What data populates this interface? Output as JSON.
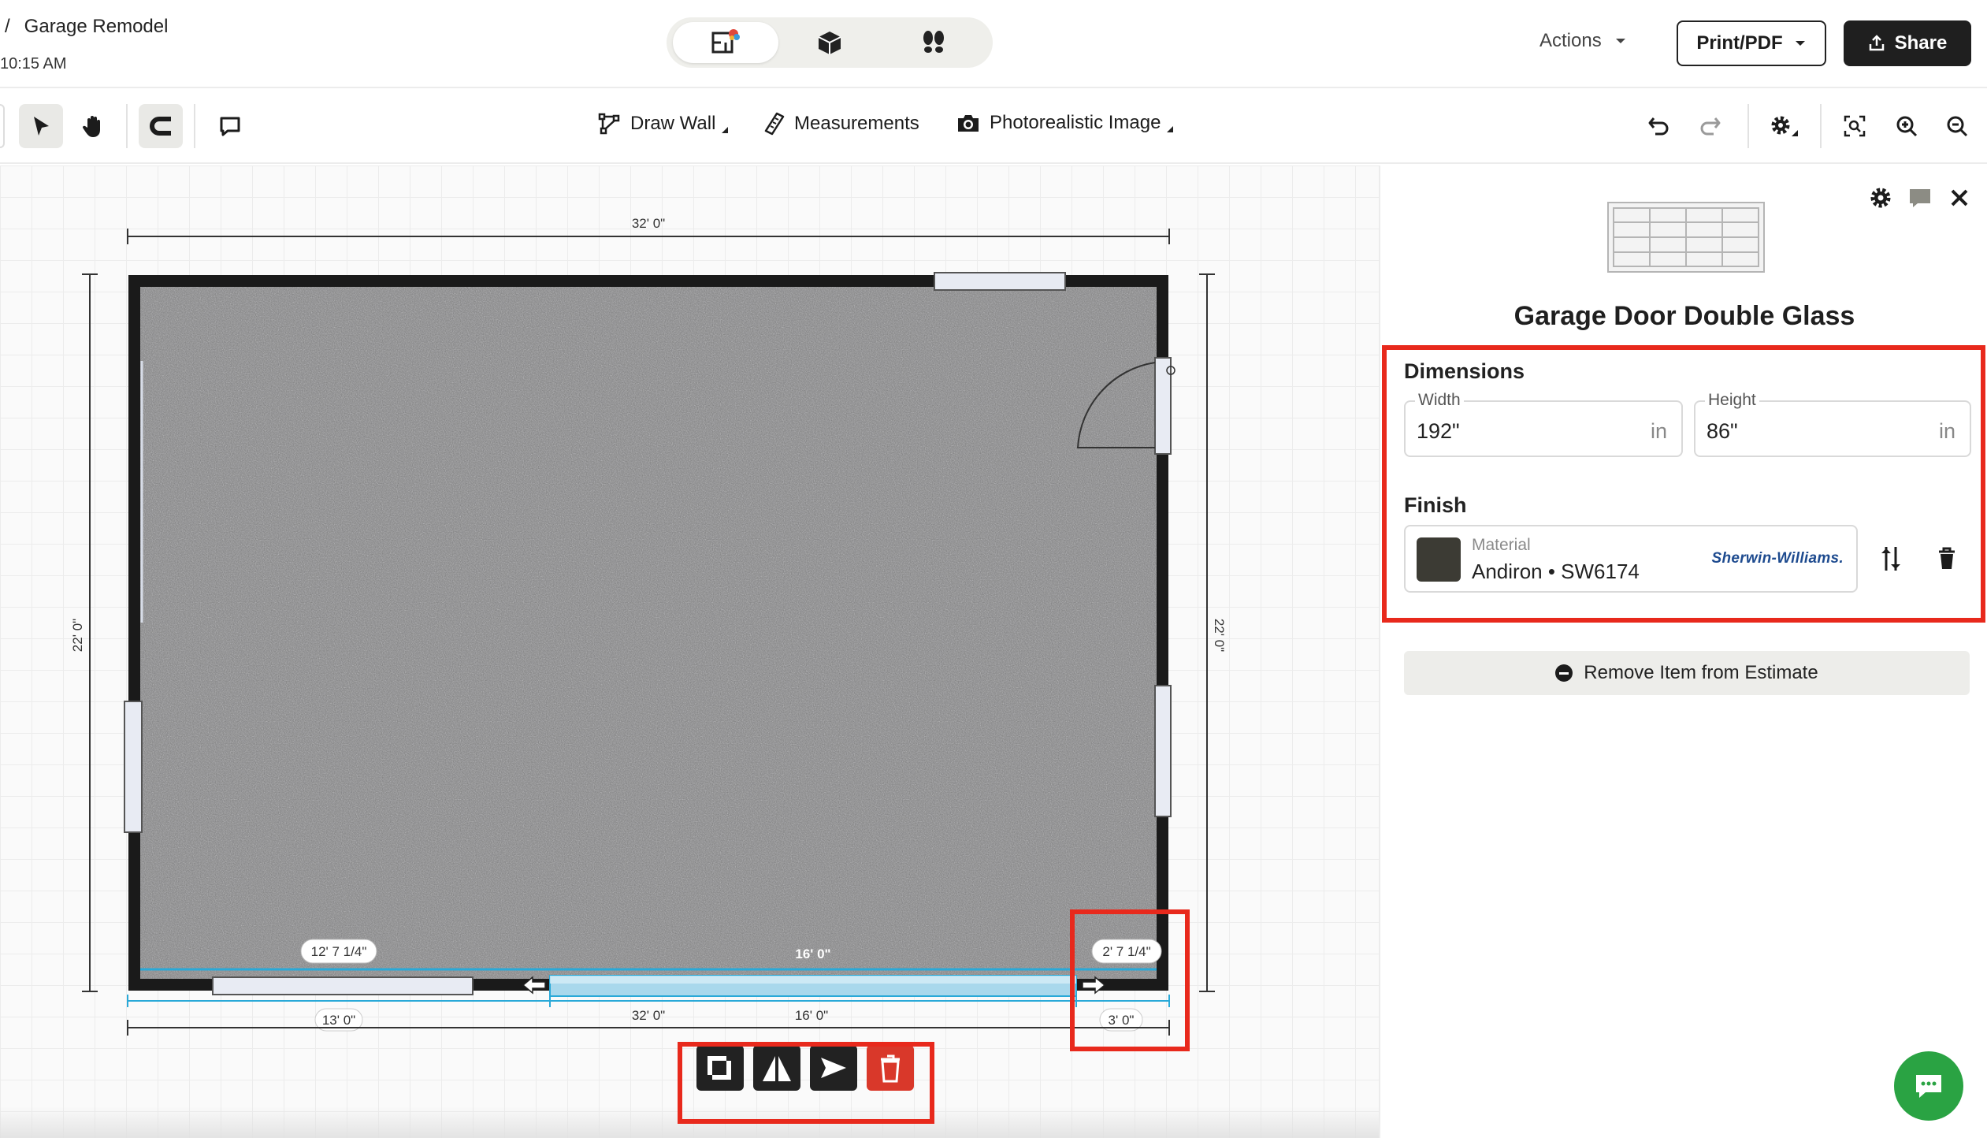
{
  "header": {
    "breadcrumb_sep": "/",
    "project_title": "Garage Remodel",
    "time": "10:15 AM",
    "actions_label": "Actions",
    "print_label": "Print/PDF",
    "share_label": "Share"
  },
  "view_modes": [
    {
      "name": "2d-floorplan",
      "active": true
    },
    {
      "name": "3d-view",
      "active": false
    },
    {
      "name": "walkthrough",
      "active": false
    }
  ],
  "toolbar": {
    "draw_wall": "Draw Wall",
    "measurements": "Measurements",
    "photorealistic": "Photorealistic Image"
  },
  "floorplan": {
    "top_dim": "32' 0\"",
    "left_dim": "22' 0\"",
    "right_dim": "22' 0\"",
    "pill_left": "12' 7 1/4\"",
    "pill_right": "2' 7 1/4\"",
    "door_width_label": "16' 0\"",
    "bottom_seg_left": "13' 0\"",
    "bottom_total": "32' 0\"",
    "bottom_mid": "16' 0\"",
    "bottom_seg_right": "3' 0\""
  },
  "panel": {
    "item_title": "Garage Door Double Glass",
    "dimensions_label": "Dimensions",
    "width_label": "Width",
    "width_value": "192\"",
    "width_unit": "in",
    "height_label": "Height",
    "height_value": "86\"",
    "height_unit": "in",
    "finish_label": "Finish",
    "material_label": "Material",
    "material_value": "Andiron • SW6174",
    "material_brand": "Sherwin-Williams.",
    "swatch_color": "#3c3b34",
    "remove_label": "Remove Item from Estimate"
  },
  "colors": {
    "accent_red": "#e8291c",
    "delete_red": "#d9382a",
    "chat_green": "#2aa343",
    "selection_blue": "#29a9d8"
  }
}
